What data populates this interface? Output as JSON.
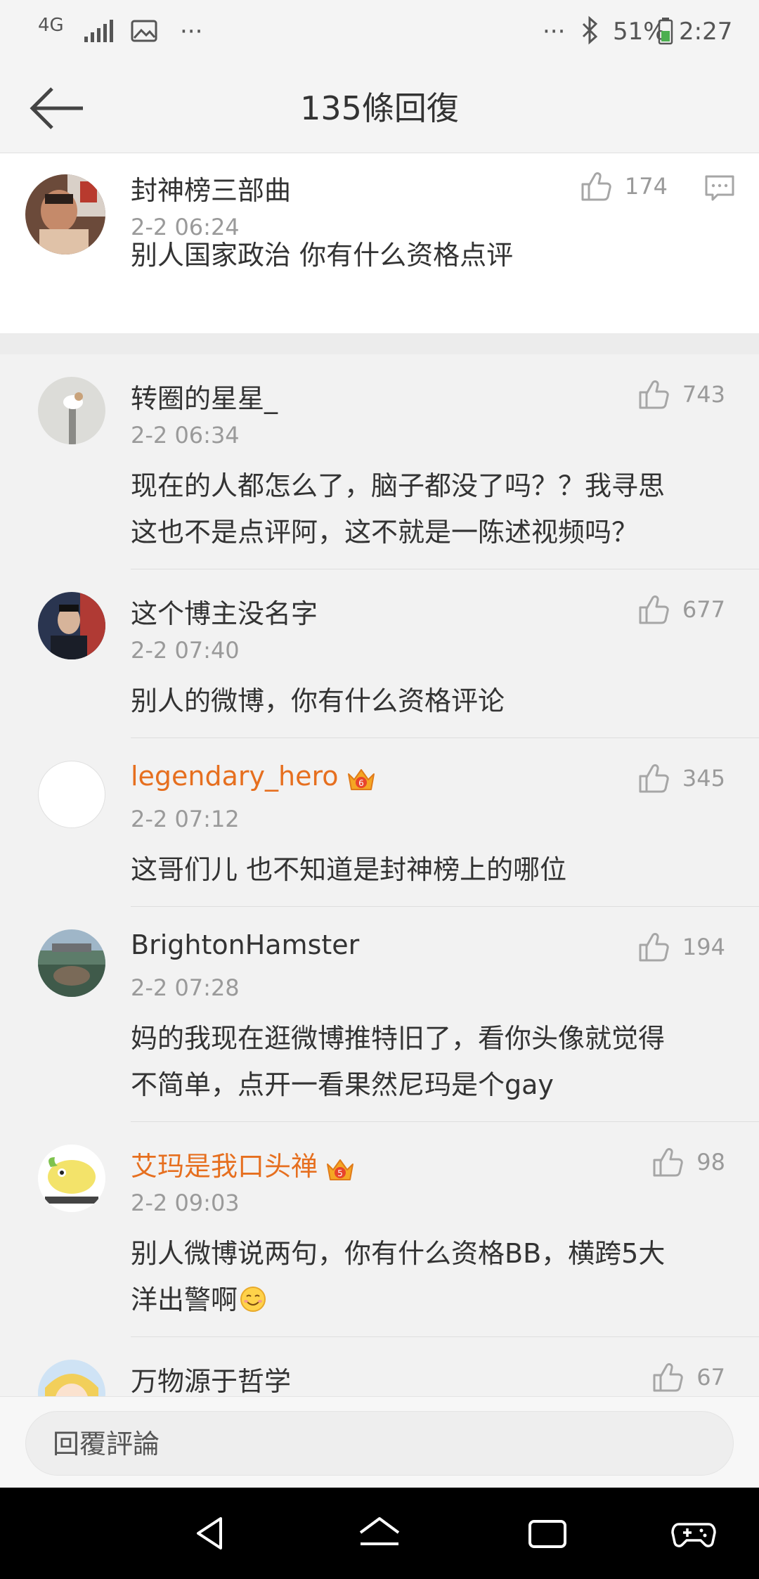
{
  "status_bar": {
    "network": "4G",
    "overflow_left": "···",
    "overflow_right": "···",
    "battery": "51%",
    "time": "2:27"
  },
  "header": {
    "title": "135條回復"
  },
  "main_comment": {
    "username": "封神榜三部曲",
    "time": "2-2 06:24",
    "likes": "174",
    "text": "别人国家政治 你有什么资格点评"
  },
  "replies": [
    {
      "username": "转圈的星星_",
      "time": "2-2 06:34",
      "likes": "743",
      "text_lines": [
        "现在的人都怎么了，脑子都没了吗？？我寻思",
        "这也不是点评阿，这不就是一陈述视频吗？"
      ],
      "vip": false
    },
    {
      "username": "这个博主没名字",
      "time": "2-2 07:40",
      "likes": "677",
      "text_lines": [
        "别人的微博，你有什么资格评论"
      ],
      "vip": false
    },
    {
      "username": "legendary_hero",
      "time": "2-2 07:12",
      "likes": "345",
      "text_lines": [
        "这哥们儿 也不知道是封神榜上的哪位"
      ],
      "vip": true,
      "vip_level": "6"
    },
    {
      "username": "BrightonHamster",
      "time": "2-2 07:28",
      "likes": "194",
      "text_lines": [
        "妈的我现在逛微博推特旧了，看你头像就觉得",
        "不简单，点开一看果然尼玛是个gay"
      ],
      "vip": false
    },
    {
      "username": "艾玛是我口头禅",
      "time": "2-2 09:03",
      "likes": "98",
      "text_lines": [
        "别人微博说两句，你有什么资格BB，横跨5大",
        "洋出警啊"
      ],
      "vip": true,
      "vip_level": "5"
    },
    {
      "username": "万物源于哲学",
      "likes": "67",
      "vip": false
    }
  ],
  "input": {
    "placeholder": "回覆評論"
  },
  "colors": {
    "vip_name": "#e66f1f",
    "secondary_text": "#9a9a9a"
  }
}
